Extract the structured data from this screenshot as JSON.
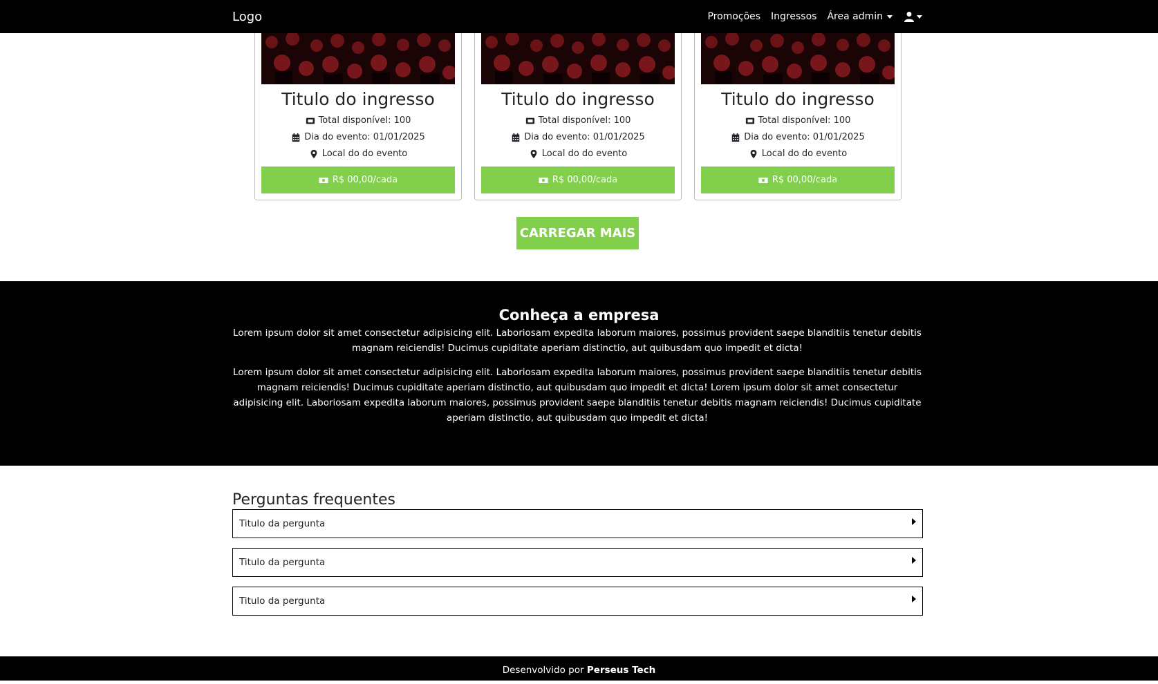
{
  "nav": {
    "logo": "Logo",
    "links": [
      "Promoções",
      "Ingressos",
      "Área admin"
    ],
    "user_icon": "user-icon"
  },
  "cards": [
    {
      "title": "Titulo do ingresso",
      "total": "Total disponível: 100",
      "date": "Dia do evento: 01/01/2025",
      "place": "Local do do evento",
      "price": "R$ 00,00/cada"
    },
    {
      "title": "Titulo do ingresso",
      "total": "Total disponível: 100",
      "date": "Dia do evento: 01/01/2025",
      "place": "Local do do evento",
      "price": "R$ 00,00/cada"
    },
    {
      "title": "Titulo do ingresso",
      "total": "Total disponível: 100",
      "date": "Dia do evento: 01/01/2025",
      "place": "Local do do evento",
      "price": "R$ 00,00/cada"
    }
  ],
  "load_more": "CARREGAR MAIS",
  "about": {
    "title": "Conheça a empresa",
    "p1": "Lorem ipsum dolor sit amet consectetur adipisicing elit. Laboriosam expedita laborum maiores, possimus provident saepe blanditiis tenetur debitis magnam reiciendis! Ducimus cupiditate aperiam distinctio, aut quibusdam quo impedit et dicta!",
    "p2": "Lorem ipsum dolor sit amet consectetur adipisicing elit. Laboriosam expedita laborum maiores, possimus provident saepe blanditiis tenetur debitis magnam reiciendis! Ducimus cupiditate aperiam distinctio, aut quibusdam quo impedit et dicta! Lorem ipsum dolor sit amet consectetur adipisicing elit. Laboriosam expedita laborum maiores, possimus provident saepe blanditiis tenetur debitis magnam reiciendis! Ducimus cupiditate aperiam distinctio, aut quibusdam quo impedit et dicta!"
  },
  "faq": {
    "title": "Perguntas frequentes",
    "items": [
      "Titulo da pergunta",
      "Titulo da pergunta",
      "Titulo da pergunta"
    ]
  },
  "footer": {
    "prefix": "Desenvolvido por ",
    "brand": "Perseus Tech"
  },
  "colors": {
    "accent": "#82cf4b",
    "dark": "#000000"
  }
}
